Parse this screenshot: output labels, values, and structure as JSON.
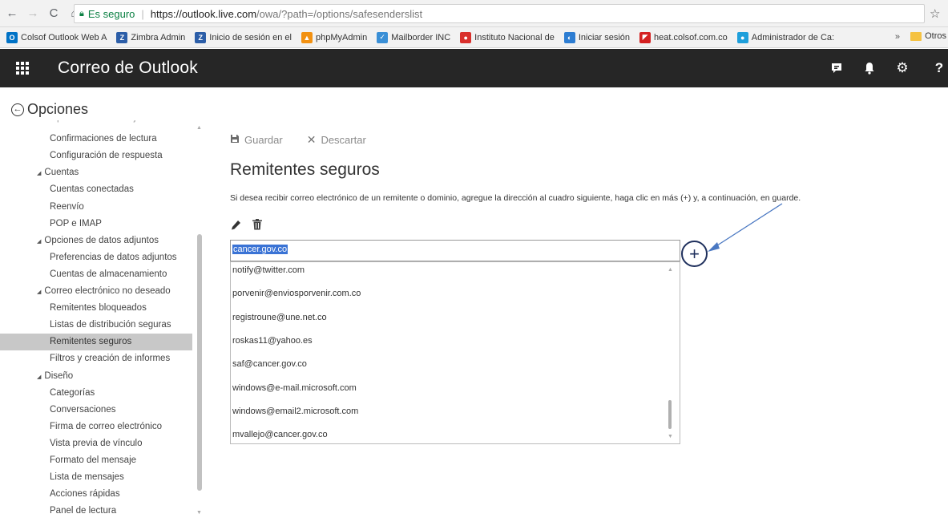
{
  "browser": {
    "secure_label": "Es seguro",
    "url_host": "https://outlook.live.com",
    "url_path": "/owa/?path=/options/safesenderslist"
  },
  "bookmarks": [
    {
      "label": "Colsof Outlook Web A",
      "color": "#0072c6",
      "glyph": "O"
    },
    {
      "label": "Zimbra Admin",
      "color": "#2c5ea8",
      "glyph": "Z"
    },
    {
      "label": "Inicio de sesión en el",
      "color": "#2c5ea8",
      "glyph": "Z"
    },
    {
      "label": "phpMyAdmin",
      "color": "#f29111",
      "glyph": "▲"
    },
    {
      "label": "Mailborder INC",
      "color": "#3a8fd6",
      "glyph": "✓"
    },
    {
      "label": "Instituto Nacional de",
      "color": "#d9302c",
      "glyph": "●"
    },
    {
      "label": "Iniciar sesión",
      "color": "#2d7dd2",
      "glyph": "◐"
    },
    {
      "label": "heat.colsof.com.co",
      "color": "#d42020",
      "glyph": "◤"
    },
    {
      "label": "Administrador de Ca:",
      "color": "#1e9fdb",
      "glyph": "●"
    }
  ],
  "bookmarks_more": "»",
  "bookmarks_other": "Otros",
  "app": {
    "title": "Correo de Outlook",
    "icons": [
      "chat-icon",
      "bell-icon",
      "gear-icon",
      "help-icon"
    ]
  },
  "options": {
    "title": "Opciones"
  },
  "nav": {
    "items": [
      {
        "label": "Opciones del mensaje",
        "level": 2
      },
      {
        "label": "Confirmaciones de lectura",
        "level": 2
      },
      {
        "label": "Configuración de respuesta",
        "level": 2
      },
      {
        "label": "Cuentas",
        "level": 1
      },
      {
        "label": "Cuentas conectadas",
        "level": 2
      },
      {
        "label": "Reenvío",
        "level": 2
      },
      {
        "label": "POP e IMAP",
        "level": 2
      },
      {
        "label": "Opciones de datos adjuntos",
        "level": 1
      },
      {
        "label": "Preferencias de datos adjuntos",
        "level": 2
      },
      {
        "label": "Cuentas de almacenamiento",
        "level": 2
      },
      {
        "label": "Correo electrónico no deseado",
        "level": 1
      },
      {
        "label": "Remitentes bloqueados",
        "level": 2
      },
      {
        "label": "Listas de distribución seguras",
        "level": 2
      },
      {
        "label": "Remitentes seguros",
        "level": 2,
        "selected": true
      },
      {
        "label": "Filtros y creación de informes",
        "level": 2
      },
      {
        "label": "Diseño",
        "level": 1
      },
      {
        "label": "Categorías",
        "level": 2
      },
      {
        "label": "Conversaciones",
        "level": 2
      },
      {
        "label": "Firma de correo electrónico",
        "level": 2
      },
      {
        "label": "Vista previa de vínculo",
        "level": 2
      },
      {
        "label": "Formato del mensaje",
        "level": 2
      },
      {
        "label": "Lista de mensajes",
        "level": 2
      },
      {
        "label": "Acciones rápidas",
        "level": 2
      },
      {
        "label": "Panel de lectura",
        "level": 2
      }
    ]
  },
  "toolbar": {
    "save_label": "Guardar",
    "discard_label": "Descartar"
  },
  "main": {
    "heading": "Remitentes seguros",
    "description": "Si desea recibir correo electrónico de un remitente o dominio, agregue la dirección al cuadro siguiente, haga clic en más (+) y, a continuación, en guarde.",
    "input_value": "cancer.gov.co",
    "add_label": "+",
    "senders": [
      "notify@twitter.com",
      "porvenir@enviosporvenir.com.co",
      "registroune@une.net.co",
      "roskas11@yahoo.es",
      "saf@cancer.gov.co",
      "windows@e-mail.microsoft.com",
      "windows@email2.microsoft.com",
      "mvallejo@cancer.gov.co"
    ]
  },
  "colors": {
    "appbar": "#262626",
    "selection": "#c8c8c8",
    "annotation": "#4a78c2"
  }
}
